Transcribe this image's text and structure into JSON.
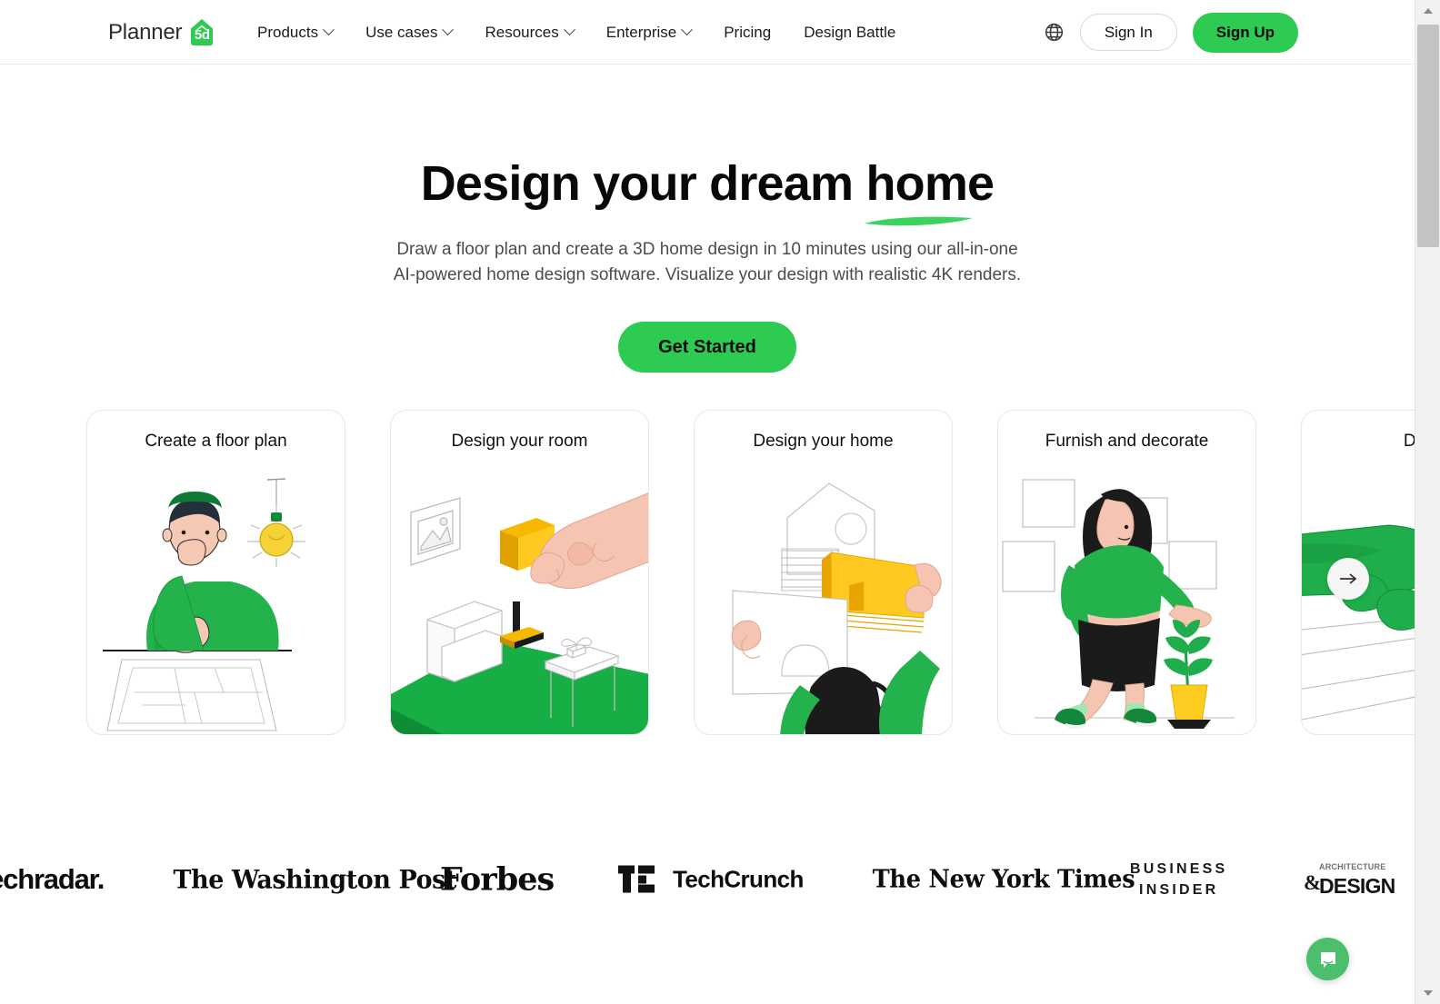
{
  "brand": {
    "logo_word": "Planner",
    "logo_badge": "5d",
    "accent_green": "#2ECB52",
    "chat_green": "#4BBF6B"
  },
  "header": {
    "nav": [
      {
        "label": "Products",
        "has_dropdown": true
      },
      {
        "label": "Use cases",
        "has_dropdown": true
      },
      {
        "label": "Resources",
        "has_dropdown": true
      },
      {
        "label": "Enterprise",
        "has_dropdown": true
      },
      {
        "label": "Pricing",
        "has_dropdown": false
      },
      {
        "label": "Design Battle",
        "has_dropdown": false
      }
    ],
    "language_icon": "globe-icon",
    "sign_in": "Sign In",
    "sign_up": "Sign Up"
  },
  "hero": {
    "title_plain": "Design your dream ",
    "title_highlight": "home",
    "subtitle": "Draw a floor plan and create a 3D home design in 10 minutes using our all-in-one AI-powered home design software. Visualize your design with realistic 4K renders.",
    "cta": "Get Started"
  },
  "cards": [
    {
      "title": "Create a floor plan",
      "art": "person-with-floorplan-and-lightbulb"
    },
    {
      "title": "Design your room",
      "art": "isometric-room-with-hand-placing-lamp"
    },
    {
      "title": "Design your home",
      "art": "person-holding-house-shapes"
    },
    {
      "title": "Furnish and decorate",
      "art": "woman-hanging-frames-with-plant"
    },
    {
      "title": "Design",
      "art": "green-robot-hand"
    }
  ],
  "carousel": {
    "next_label": "→"
  },
  "press": {
    "logos": [
      {
        "name": "techradar",
        "text": "techradar."
      },
      {
        "name": "washington-post",
        "text": "The Washington Post"
      },
      {
        "name": "forbes",
        "text": "Forbes"
      },
      {
        "name": "techcrunch",
        "text": "TechCrunch"
      },
      {
        "name": "new-york-times",
        "text": "The New York Times"
      },
      {
        "name": "business-insider",
        "line1": "BUSINESS",
        "line2": "INSIDER"
      },
      {
        "name": "architecture-and-design",
        "line1": "ARCHITECTURE",
        "line2": "DESIGN"
      }
    ]
  },
  "chat": {
    "label": "chat-bubble-icon"
  },
  "scrollbar": {
    "position": "near-top"
  }
}
